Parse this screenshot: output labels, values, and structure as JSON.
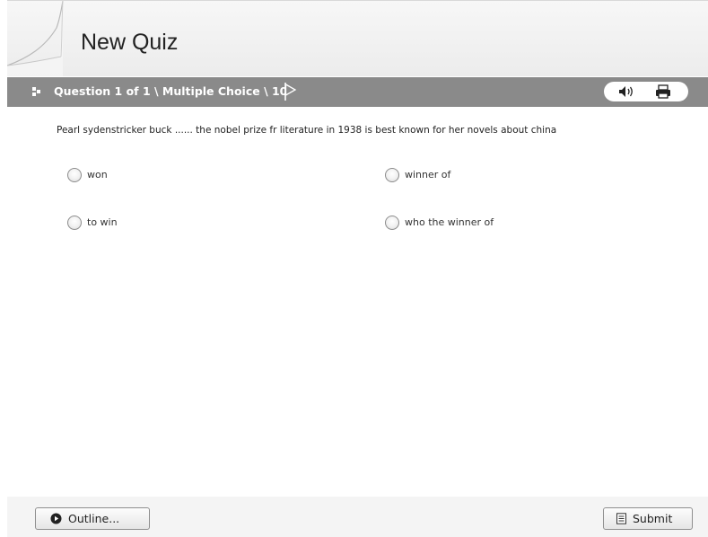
{
  "quiz": {
    "title": "New Quiz"
  },
  "question_bar": {
    "label": "Question 1 of 1 \\ Multiple Choice \\ 10",
    "tools": [
      {
        "name": "audio",
        "icon": "speaker-icon"
      },
      {
        "name": "print",
        "icon": "printer-icon"
      }
    ]
  },
  "question": {
    "text": "Pearl sydenstricker buck ...... the nobel prize fr literature in 1938 is best known for her novels about china",
    "options": [
      {
        "label": "won",
        "selected": false
      },
      {
        "label": "winner of",
        "selected": false
      },
      {
        "label": "to win",
        "selected": false
      },
      {
        "label": "who the winner of",
        "selected": false
      }
    ]
  },
  "footer": {
    "outline_label": "Outline...",
    "submit_label": "Submit"
  },
  "colors": {
    "header_bar": "#8a8a8a",
    "title_bg": "#ececec",
    "footer_bg": "#f4f4f4",
    "text": "#222222"
  }
}
